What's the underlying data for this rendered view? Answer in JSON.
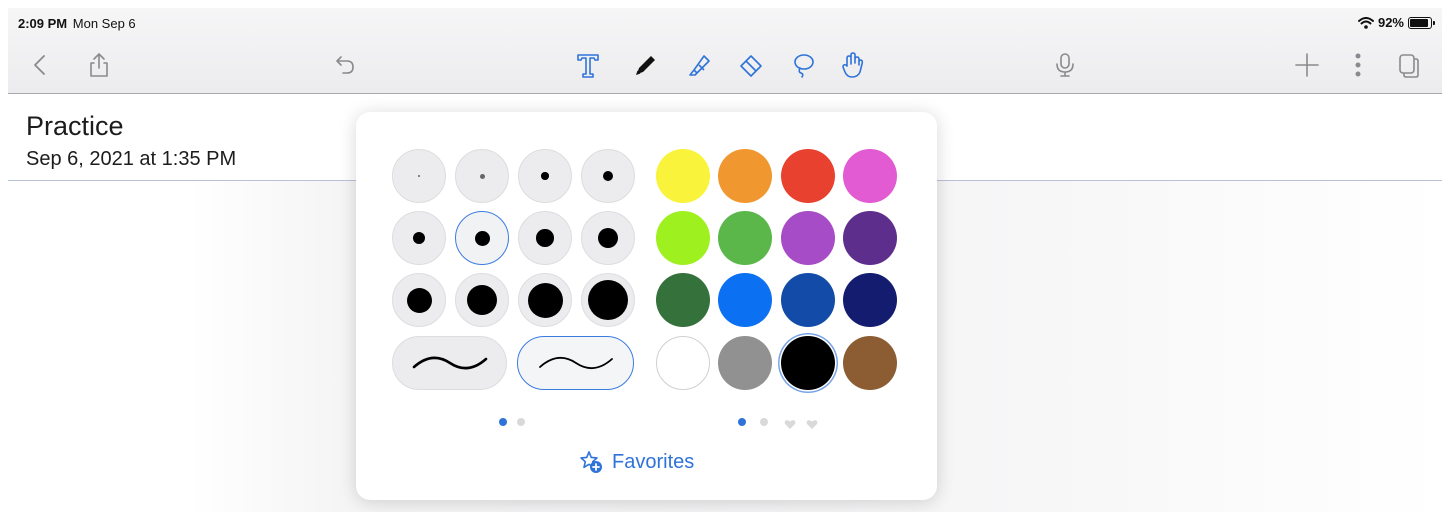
{
  "status_bar": {
    "time": "2:09 PM",
    "date": "Mon Sep 6",
    "battery": "92%",
    "battery_level": 0.92
  },
  "toolbar": {
    "left_icons": [
      "back-chevron-icon",
      "share-icon",
      "undo-icon"
    ],
    "tool_icons": [
      "text-tool-icon",
      "pen-tool-icon",
      "highlighter-tool-icon",
      "eraser-tool-icon",
      "lasso-tool-icon",
      "hand-tool-icon"
    ],
    "selected_tool": "pen-tool-icon",
    "right_icons": [
      "microphone-icon",
      "add-icon",
      "more-icon",
      "pages-icon"
    ],
    "accent_color": "#2f73d9"
  },
  "note": {
    "title": "Practice",
    "date": "Sep 6, 2021 at 1:35 PM"
  },
  "pen_popover": {
    "sizes": [
      0.5,
      1,
      1.5,
      2,
      2.5,
      3,
      3.5,
      4,
      5,
      6,
      7,
      8
    ],
    "selected_size_index": 5,
    "stroke_styles": [
      "pressure-stroke",
      "smooth-stroke"
    ],
    "selected_stroke_index": 1,
    "colors": [
      "#f9f33b",
      "#f0982f",
      "#e8412f",
      "#e25bd3",
      "#9ff01f",
      "#5bb74a",
      "#a64cc6",
      "#5e2e8d",
      "#35713b",
      "#0b70f2",
      "#134ca8",
      "#141c70",
      "#ffffff",
      "#919191",
      "#000000",
      "#8c5d33"
    ],
    "selected_color_index": 14,
    "size_pages": 2,
    "size_page_active": 0,
    "color_pages": 2,
    "color_page_active": 0,
    "favorite_pages": 2,
    "favorites_label": "Favorites"
  }
}
